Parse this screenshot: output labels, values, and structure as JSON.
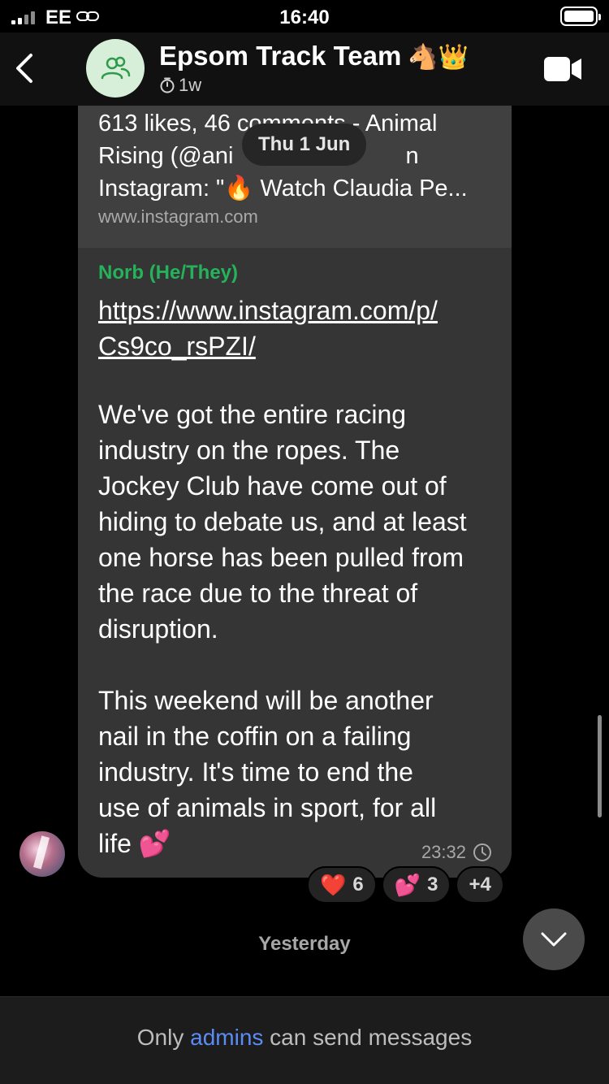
{
  "status_bar": {
    "carrier": "EE",
    "time": "16:40"
  },
  "header": {
    "title": "Epsom Track Team",
    "title_emoji": "🐴👑",
    "subtitle": "1w",
    "icons": {
      "back": "chevron-left-icon",
      "avatar": "group-icon",
      "timer": "timer-icon",
      "video": "video-camera-icon"
    }
  },
  "message": {
    "preview": {
      "line1": "613 likes, 46 comments - Animal",
      "line2": "Rising (@ani",
      "line2_tail": "n",
      "line3": "Instagram: \"🔥 Watch Claudia Pe...",
      "domain": "www.instagram.com"
    },
    "date_pill": "Thu 1 Jun",
    "sender": "Norb (He/They)",
    "link_line1": "https://www.instagram.com/p/",
    "link_line2": "Cs9co_rsPZI/",
    "body_lines": [
      "We've got the entire racing",
      "industry on the ropes. The",
      "Jockey Club have come out of",
      "hiding to debate us, and at least",
      "one horse has been pulled from",
      "the race due to the threat of",
      "disruption.",
      "",
      "This weekend will be another",
      "nail in the coffin on a failing",
      "industry. It's time to end the",
      "use of animals in sport, for all",
      "life 💕"
    ],
    "time": "23:32"
  },
  "reactions": [
    {
      "emoji": "❤️",
      "count": "6"
    },
    {
      "emoji": "💕",
      "count": "3"
    },
    {
      "emoji": "",
      "count": "+4"
    }
  ],
  "day_separator": "Yesterday",
  "footer": {
    "prefix": "Only",
    "link": "admins",
    "suffix": "can send messages"
  }
}
